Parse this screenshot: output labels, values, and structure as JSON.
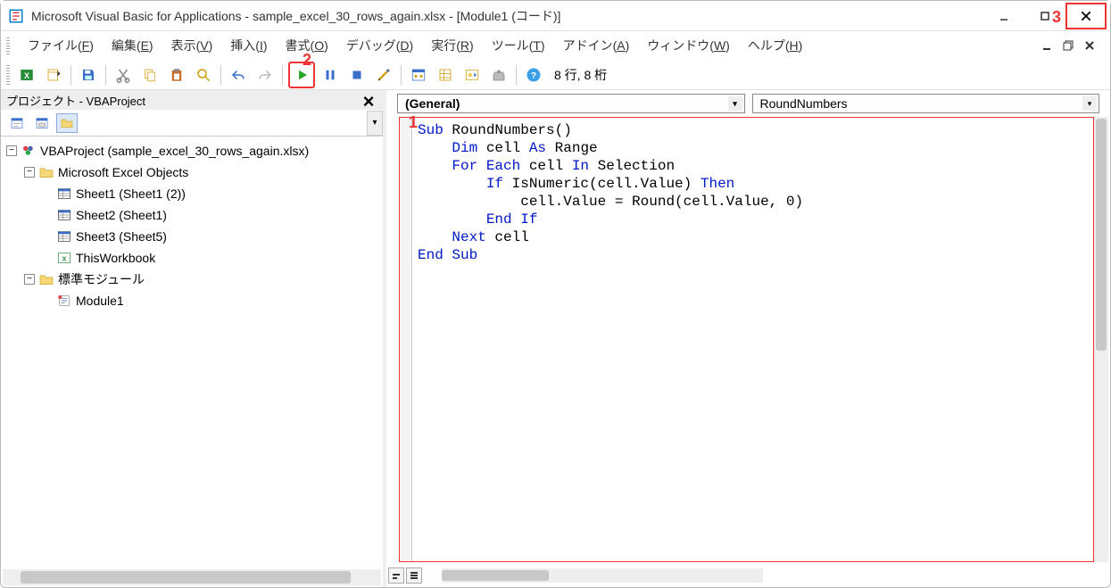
{
  "window": {
    "title": "Microsoft Visual Basic for Applications - sample_excel_30_rows_again.xlsx - [Module1 (コード)]"
  },
  "markers": {
    "m1": "1",
    "m2": "2",
    "m3": "3"
  },
  "menu": {
    "file": "ファイル",
    "file_u": "F",
    "edit": "編集",
    "edit_u": "E",
    "view": "表示",
    "view_u": "V",
    "insert": "挿入",
    "insert_u": "I",
    "format": "書式",
    "format_u": "O",
    "debug": "デバッグ",
    "debug_u": "D",
    "run": "実行",
    "run_u": "R",
    "tools": "ツール",
    "tools_u": "T",
    "addins": "アドイン",
    "addins_u": "A",
    "window": "ウィンドウ",
    "window_u": "W",
    "help": "ヘルプ",
    "help_u": "H"
  },
  "toolbar": {
    "status": "8 行, 8 桁"
  },
  "project": {
    "title": "プロジェクト - VBAProject",
    "root": "VBAProject (sample_excel_30_rows_again.xlsx)",
    "objects": "Microsoft Excel Objects",
    "sheet1": "Sheet1 (Sheet1 (2))",
    "sheet2": "Sheet2 (Sheet1)",
    "sheet3": "Sheet3 (Sheet5)",
    "thiswb": "ThisWorkbook",
    "stdmod": "標準モジュール",
    "module1": "Module1"
  },
  "codepane": {
    "object": "(General)",
    "proc": "RoundNumbers"
  },
  "code": {
    "l1a": "Sub",
    "l1b": " RoundNumbers()",
    "l2a": "    ",
    "l2b": "Dim",
    "l2c": " cell ",
    "l2d": "As",
    "l2e": " Range",
    "l3a": "    ",
    "l3b": "For Each",
    "l3c": " cell ",
    "l3d": "In",
    "l3e": " Selection",
    "l4a": "        ",
    "l4b": "If",
    "l4c": " IsNumeric(cell.Value) ",
    "l4d": "Then",
    "l5a": "            cell.Value = Round(cell.Value, 0)",
    "l6a": "        ",
    "l6b": "End If",
    "l7a": "    ",
    "l7b": "Next",
    "l7c": " cell",
    "l8a": "End Sub"
  }
}
